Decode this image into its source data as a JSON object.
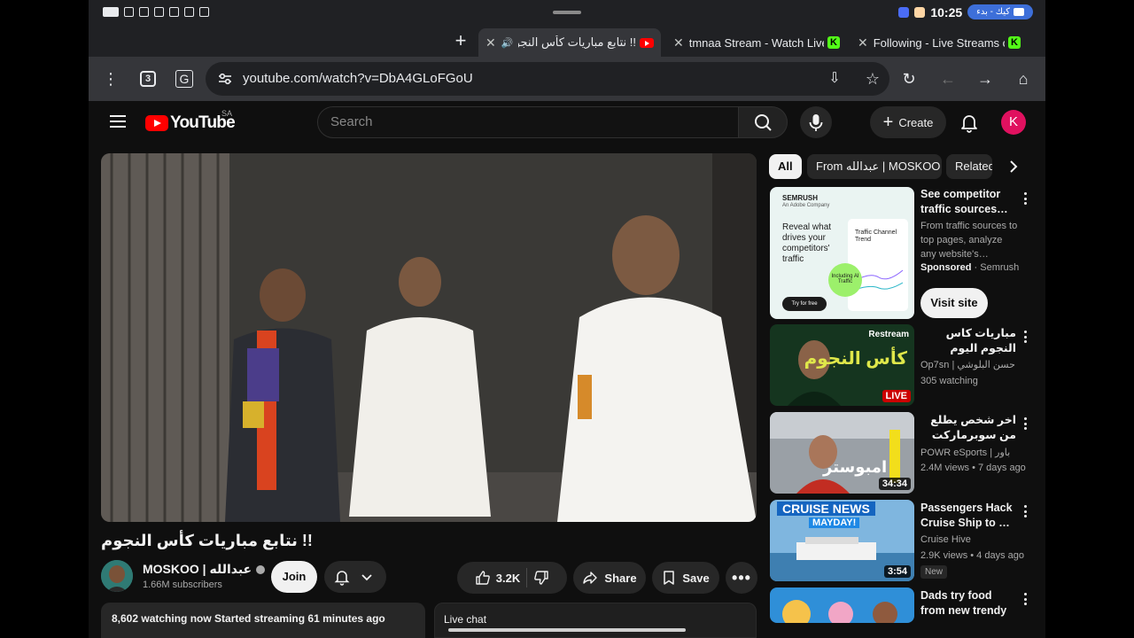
{
  "status": {
    "time": "10:25",
    "pill": "كيك - بدء"
  },
  "tabs": [
    {
      "title": "!! نتابع مباريات كأس النجوم -",
      "favicon": "youtube-icon",
      "active": true
    },
    {
      "title": "tmnaa Stream - Watch Live",
      "favicon": "kick-icon",
      "active": false
    },
    {
      "title": "Following - Live Streams on",
      "favicon": "kick-icon",
      "active": false
    }
  ],
  "toolbar": {
    "tab_count": "3",
    "url": "youtube.com/watch?v=DbA4GLoFGoU"
  },
  "youtube": {
    "logo_word": "YouTube",
    "country": "SA",
    "search_placeholder": "Search",
    "create_label": "Create",
    "avatar_letter": "K"
  },
  "video": {
    "title": "!! نتابع مباريات كأس النجوم",
    "channel": "MOSKOO | عبدالله",
    "subscribers": "1.66M subscribers",
    "join_label": "Join",
    "likes": "3.2K",
    "share_label": "Share",
    "save_label": "Save",
    "description": "8,602 watching now  Started streaming 61 minutes ago",
    "live_chat": "Live chat"
  },
  "chips": [
    "All",
    "From عبدالله | MOSKOO",
    "Related"
  ],
  "sidebar": {
    "ad": {
      "title": "See competitor traffic sources…",
      "desc": "From traffic sources to top pages, analyze any website's…",
      "sponsored": "Sponsored",
      "advertiser": "· Semrush",
      "cta": "Visit site",
      "thumb_brand": "SEMRUSH",
      "thumb_sub": "An Adobe Company",
      "thumb_headline": "Reveal what drives your competitors' traffic",
      "thumb_card": "Traffic Channel Trend",
      "thumb_badge": "Including AI Traffic",
      "thumb_btn": "Try for free"
    },
    "items": [
      {
        "title": "مباريات كاس النجوم اليوم الثاني 🔥🤩",
        "channel": "Op7sn | حسن البلوشي",
        "meta": "305 watching",
        "badge": "LIVE",
        "thumb_text": "Restream",
        "thumb_big": "كأس النجوم"
      },
      {
        "title": "اخر شخص يطلع من سوبرماركت يفوز ب …",
        "channel": "POWR eSports | باور",
        "meta": "2.4M views • 7 days ago",
        "duration": "34:34",
        "thumb_big": "امبوستر"
      },
      {
        "title": "Passengers Hack Cruise Ship to …",
        "channel": "Cruise Hive",
        "meta": "2.9K views • 4 days ago",
        "duration": "3:54",
        "new_label": "New",
        "thumb_big": "CRUISE NEWS",
        "thumb_sub": "MAYDAY!"
      },
      {
        "title": "Dads try food from new trendy …"
      }
    ]
  }
}
